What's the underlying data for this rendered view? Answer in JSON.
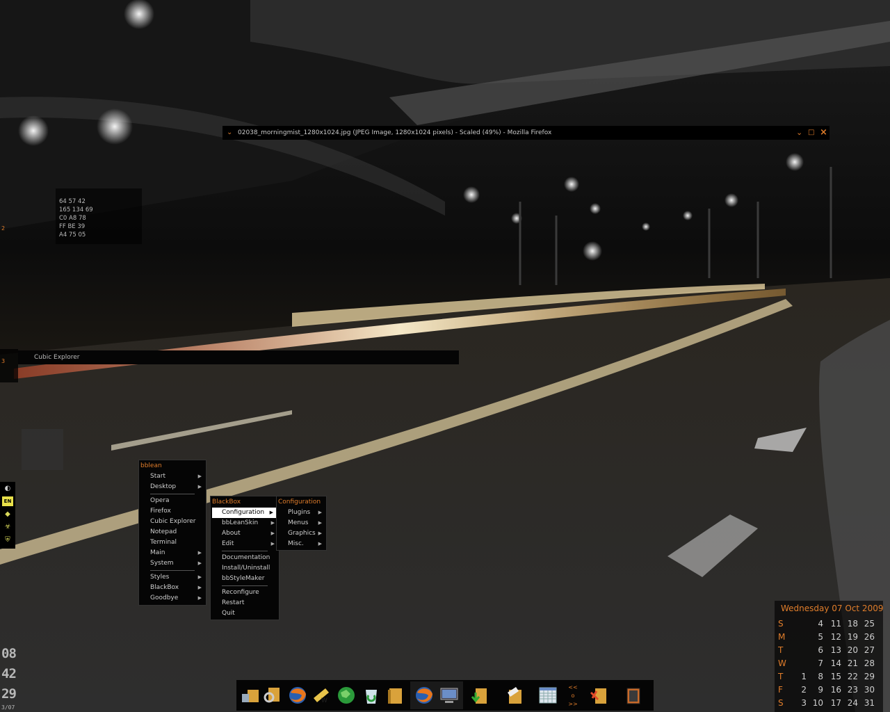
{
  "firefox_window": {
    "title": "02038_morningmist_1280x1024.jpg (JPEG Image, 1280x1024 pixels) - Scaled (49%) - Mozilla Firefox",
    "menu_icon": "chevron-down-icon",
    "minimize_icon": "minimize-icon",
    "maximize_icon": "maximize-icon",
    "close_icon": "close-icon"
  },
  "color_readout": [
    "64 57 42",
    "165 134 69",
    "C0 A8 78",
    "FF BE 39",
    "A4 75 05"
  ],
  "workspace_labels": [
    "2",
    "3"
  ],
  "cubic_explorer": {
    "title": "Cubic Explorer"
  },
  "tray_icons": [
    "network-icon",
    "EN",
    "tag-icon",
    "biohazard-icon",
    "shield-icon"
  ],
  "main_menu": {
    "title": "bblean",
    "items": [
      {
        "label": "Start",
        "submenu": true
      },
      {
        "label": "Desktop",
        "submenu": true
      },
      {
        "label": "Opera",
        "submenu": false
      },
      {
        "label": "Firefox",
        "submenu": false
      },
      {
        "label": "Cubic Explorer",
        "submenu": false
      },
      {
        "label": "Notepad",
        "submenu": false
      },
      {
        "label": "Terminal",
        "submenu": false
      },
      {
        "label": "Main",
        "submenu": true
      },
      {
        "label": "System",
        "submenu": true
      },
      {
        "label": "Styles",
        "submenu": true
      },
      {
        "label": "BlackBox",
        "submenu": true
      },
      {
        "label": "Goodbye",
        "submenu": true
      }
    ]
  },
  "blackbox_menu": {
    "title": "BlackBox",
    "items": [
      {
        "label": "Configuration",
        "submenu": true,
        "selected": true
      },
      {
        "label": "bbLeanSkin",
        "submenu": true
      },
      {
        "label": "About",
        "submenu": true
      },
      {
        "label": "Edit",
        "submenu": true
      },
      {
        "label": "Documentation"
      },
      {
        "label": "Install/Uninstall"
      },
      {
        "label": "bbStyleMaker"
      },
      {
        "label": "Reconfigure"
      },
      {
        "label": "Restart"
      },
      {
        "label": "Quit"
      }
    ]
  },
  "config_menu": {
    "title": "Configuration",
    "items": [
      {
        "label": "Plugins",
        "submenu": true
      },
      {
        "label": "Menus",
        "submenu": true
      },
      {
        "label": "Graphics",
        "submenu": true
      },
      {
        "label": "Misc.",
        "submenu": true
      }
    ]
  },
  "clock": {
    "hour": "08",
    "minute": "42",
    "second": "29",
    "date": "3/07"
  },
  "taskbar": {
    "icons": [
      "explorer-icon",
      "search-folder-icon",
      "firefox-icon",
      "writer-icon",
      "globe-icon",
      "recycle-bin-icon",
      "folder-icon",
      "firefox-active-icon",
      "monitor-icon",
      "downloads-folder-icon",
      "notepad-folder-icon",
      "calendar-grid-icon",
      "tools-folder-icon",
      "book-icon"
    ],
    "nav": [
      "<<",
      "o",
      ">>"
    ]
  },
  "calendar": {
    "header": "Wednesday 07 Oct  2009",
    "rows": [
      {
        "day": "S",
        "dates": [
          "",
          "4",
          "11",
          "18",
          "25"
        ]
      },
      {
        "day": "M",
        "dates": [
          "",
          "5",
          "12",
          "19",
          "26"
        ]
      },
      {
        "day": "T",
        "dates": [
          "",
          "6",
          "13",
          "20",
          "27"
        ]
      },
      {
        "day": "W",
        "dates": [
          "",
          "7",
          "14",
          "21",
          "28"
        ]
      },
      {
        "day": "T",
        "dates": [
          "1",
          "8",
          "15",
          "22",
          "29"
        ]
      },
      {
        "day": "F",
        "dates": [
          "2",
          "9",
          "16",
          "23",
          "30"
        ]
      },
      {
        "day": "S",
        "dates": [
          "3",
          "10",
          "17",
          "24",
          "31"
        ]
      }
    ]
  },
  "colors": {
    "accent": "#e07d2b",
    "menu_bg": "#050505",
    "text": "#cfcfcf"
  }
}
